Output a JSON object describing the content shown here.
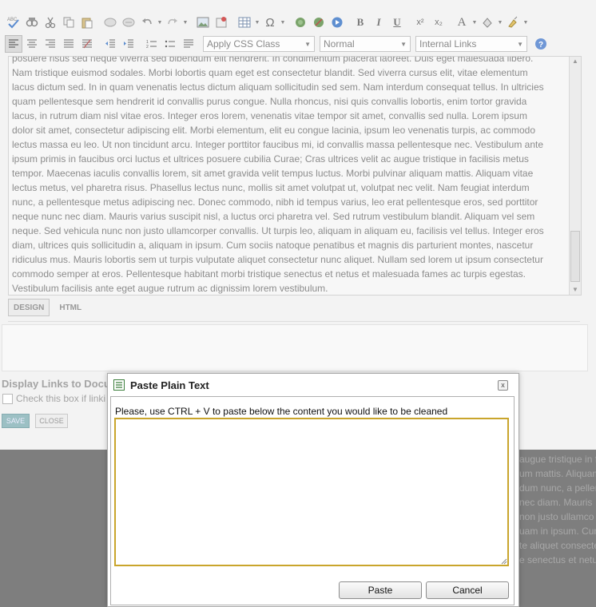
{
  "toolbar": {
    "css_class_select": "Apply CSS Class",
    "paragraph_select": "Normal",
    "links_select": "Internal Links",
    "bold": "B",
    "italic": "I",
    "underline": "U",
    "superscript": "x²",
    "subscript": "x₂",
    "font_color": "A",
    "omega": "Ω",
    "spell_label": "ABC"
  },
  "editor": {
    "lines": [
      "posuere risus sed neque viverra sed bibendum elit hendrerit. In condimentum placerat laoreet. Duis eget malesuada libero.",
      "Nam tristique euismod sodales. Morbi lobortis quam eget est consectetur blandit. Sed viverra cursus elit, vitae elementum",
      "lacus dictum sed. In in quam venenatis lectus dictum aliquam sollicitudin sed sem. Nam interdum consequat tellus. In ultricies",
      "quam pellentesque sem hendrerit id convallis purus congue. Nulla rhoncus, nisi quis convallis lobortis, enim tortor gravida",
      "lacus, in rutrum diam nisl vitae eros. Integer eros lorem, venenatis vitae tempor sit amet, convallis sed nulla. Lorem ipsum",
      "dolor sit amet, consectetur adipiscing elit. Morbi elementum, elit eu congue lacinia, ipsum leo venenatis turpis, ac commodo",
      "lectus massa eu leo. Ut non tincidunt arcu. Integer porttitor faucibus mi, id convallis massa pellentesque nec. Vestibulum ante",
      "ipsum primis in faucibus orci luctus et ultrices posuere cubilia Curae; Cras ultrices velit ac augue tristique in facilisis metus",
      "tempor. Maecenas iaculis convallis lorem, sit amet gravida velit tempus luctus. Morbi pulvinar aliquam mattis. Aliquam vitae",
      "lectus metus, vel pharetra risus. Phasellus lectus nunc, mollis sit amet volutpat ut, volutpat nec velit. Nam feugiat interdum",
      "nunc, a pellentesque metus adipiscing nec. Donec commodo, nibh id tempus varius, leo erat pellentesque eros, sed porttitor",
      "neque nunc nec diam. Mauris varius suscipit nisl, a luctus orci pharetra vel. Sed rutrum vestibulum blandit. Aliquam vel sem",
      "neque. Sed vehicula nunc non justo ullamcorper convallis. Ut turpis leo, aliquam in aliquam eu, facilisis vel tellus. Integer eros",
      "diam, ultrices quis sollicitudin a, aliquam in ipsum. Cum sociis natoque penatibus et magnis dis parturient montes, nascetur",
      "ridiculus mus. Mauris lobortis sem ut turpis vulputate aliquet consectetur nunc aliquet. Nullam sed lorem ut ipsum consectetur",
      "commodo semper at eros. Pellentesque habitant morbi tristique senectus et netus et malesuada fames ac turpis egestas.",
      "Vestibulum facilisis ante eget augue rutrum ac dignissim lorem vestibulum."
    ],
    "mode_tabs": [
      "DESIGN",
      "HTML"
    ]
  },
  "panel": {
    "links_label": "Display Links to Docu",
    "checkbox_label": "Check this box if linki",
    "save_label": "SAVE",
    "close_label": "CLOSE"
  },
  "background_text": [
    "augue tristique in f",
    "um mattis. Aliquam",
    "dum nunc, a pellen",
    "nec diam. Mauris",
    "non justo ullamco",
    "uam in ipsum. Cum",
    "te aliquet consecte",
    "e senectus et netus"
  ],
  "dialog": {
    "title": "Paste Plain Text",
    "instruction": "Please, use CTRL + V to paste below the content you would like to be cleaned",
    "textarea_value": "",
    "paste_label": "Paste",
    "cancel_label": "Cancel",
    "close_glyph": "x"
  },
  "colors": {
    "textarea_border": "#c9a52c",
    "save_button": "#9cc0c4",
    "overlay": "#7e7e7e"
  }
}
